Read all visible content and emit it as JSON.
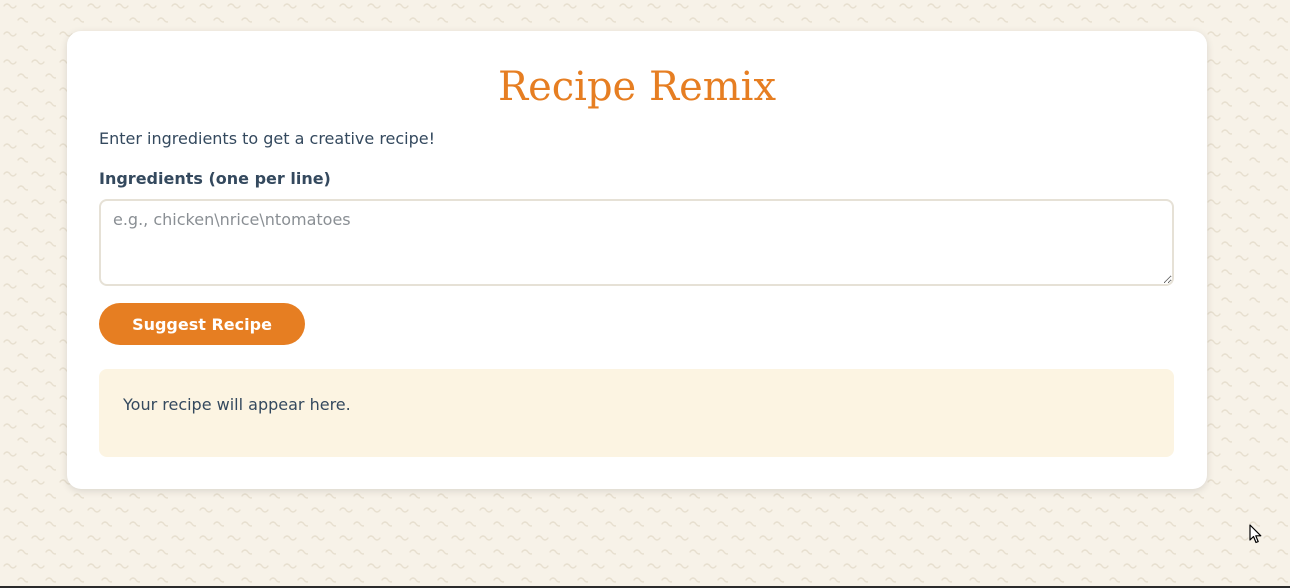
{
  "app": {
    "title": "Recipe Remix",
    "subtitle": "Enter ingredients to get a creative recipe!"
  },
  "form": {
    "ingredients_label": "Ingredients (one per line)",
    "ingredients_placeholder": "e.g., chicken\\nrice\\ntomatoes",
    "ingredients_value": "",
    "suggest_button_label": "Suggest Recipe"
  },
  "result": {
    "text": "Your recipe will appear here."
  },
  "colors": {
    "accent": "#e67e22",
    "text": "#34495e",
    "result_background": "#fcf4e2",
    "page_background": "#f7f2e8"
  },
  "icons": {
    "cursor": "mouse-pointer-icon"
  }
}
